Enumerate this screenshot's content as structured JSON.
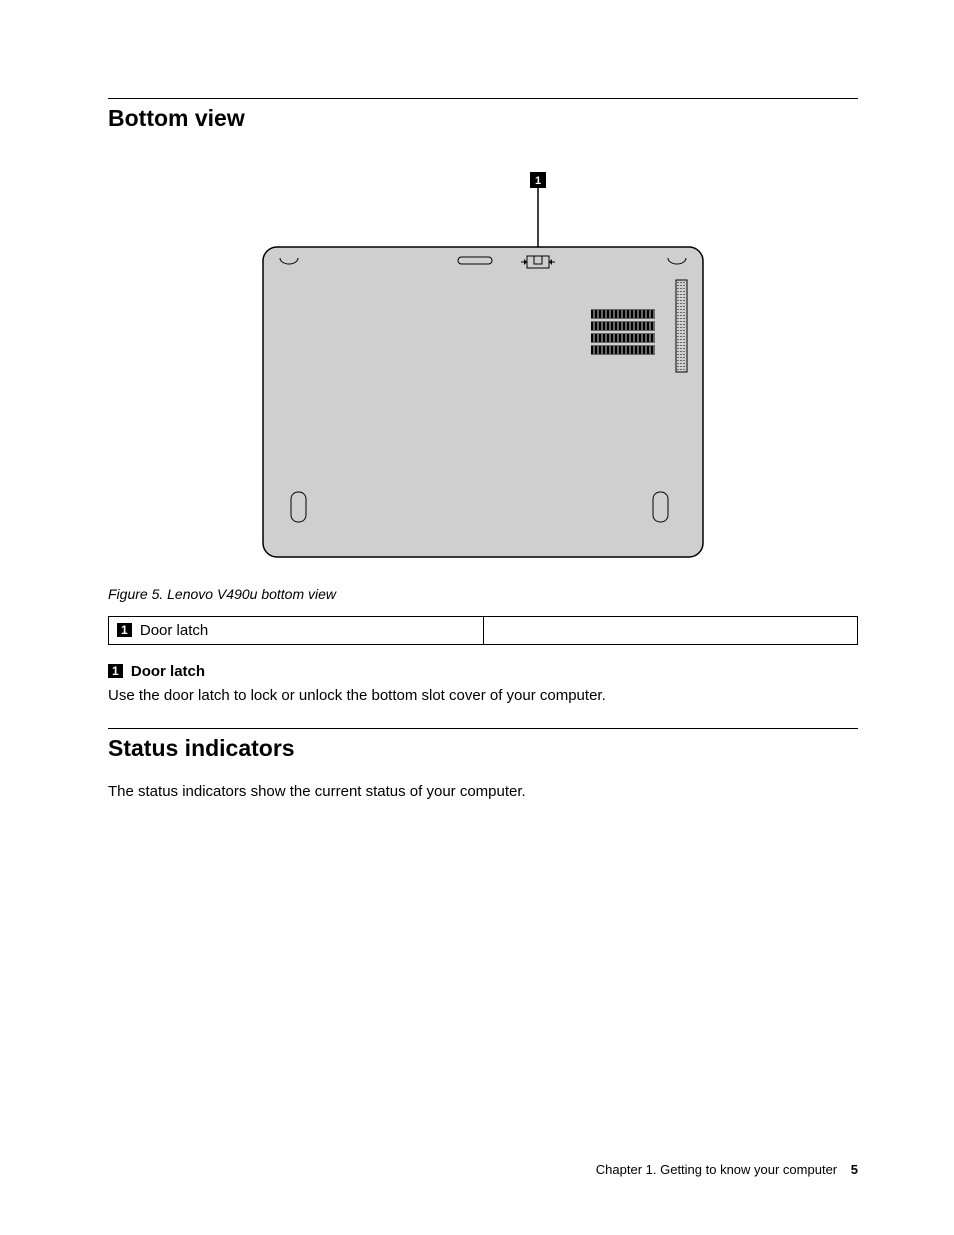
{
  "sections": {
    "bottom_view": {
      "heading": "Bottom view",
      "callout_label": "1",
      "figure_caption": "Figure 5.  Lenovo V490u bottom view",
      "legend": {
        "cell1_num": "1",
        "cell1_label": "Door latch"
      },
      "item": {
        "num": "1",
        "title": "Door latch",
        "body": "Use the door latch to lock or unlock the bottom slot cover of your computer."
      }
    },
    "status_indicators": {
      "heading": "Status indicators",
      "body": "The status indicators show the current status of your computer."
    }
  },
  "footer": {
    "chapter": "Chapter 1.  Getting to know your computer",
    "page": "5"
  }
}
